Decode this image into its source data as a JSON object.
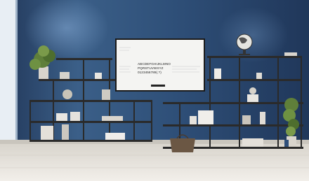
{
  "scene": {
    "wall_color": "#2f4e72",
    "floor_color": "#e4e0d9",
    "shelf_color": "#2a2a2a"
  },
  "tv": {
    "lines": [
      "ABCDEFGHIJKLMNO",
      "PQRSTUVWXYZ",
      "0123456789(.?)"
    ]
  }
}
